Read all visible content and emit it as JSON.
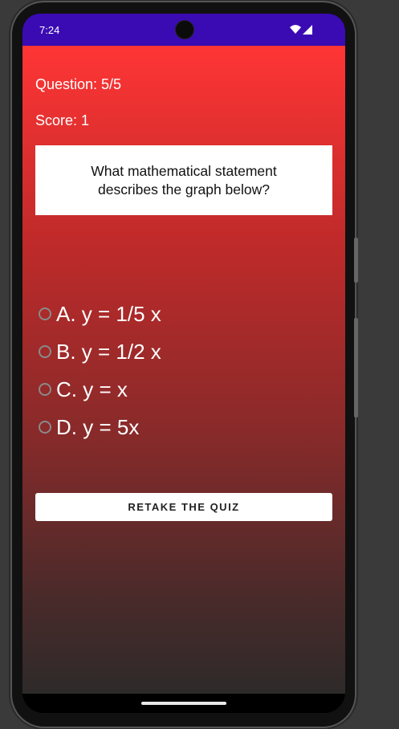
{
  "status_bar": {
    "time": "7:24"
  },
  "quiz": {
    "question_counter": "Question: 5/5",
    "score": "Score: 1",
    "question_text": "What mathematical statement describes the graph below?",
    "options": [
      {
        "label": "A. y = 1/5 x",
        "selected": false
      },
      {
        "label": "B. y = 1/2 x",
        "selected": false
      },
      {
        "label": "C. y = x",
        "selected": false
      },
      {
        "label": "D. y = 5x",
        "selected": false
      }
    ],
    "retake_button": "RETAKE THE QUIZ"
  },
  "colors": {
    "status_bar": "#3a0bb3",
    "gradient_top": "#ff3535",
    "gradient_bottom": "#2e2a2a"
  },
  "icons": [
    "wifi-icon",
    "cellular-signal-icon",
    "front-camera-icon"
  ]
}
